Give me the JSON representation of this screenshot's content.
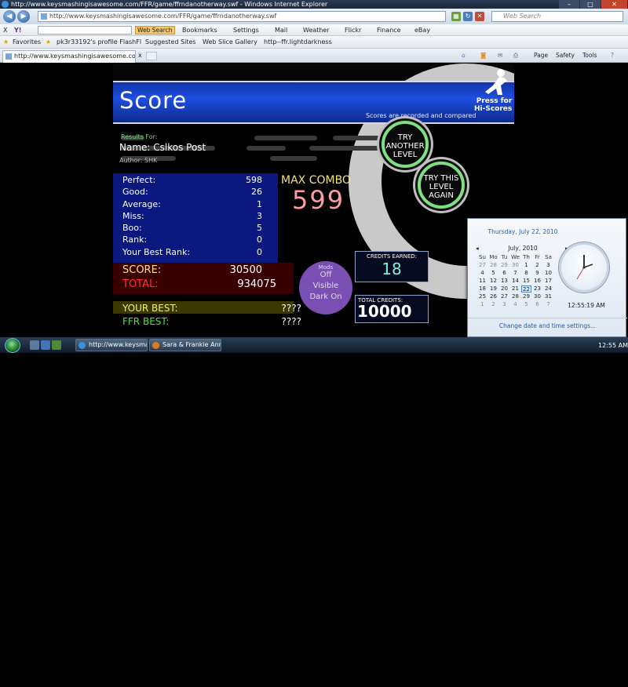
{
  "window": {
    "title": "http://www.keysmashingisawesome.com/FFR/game/ffrndanotherway.swf - Windows Internet Explorer",
    "minimize": "–",
    "maximize": "□",
    "close": "✕"
  },
  "address_bar": {
    "url": "http://www.keysmashingisawesome.com/FFR/game/ffrndanotherway.swf",
    "search_placeholder": "Web Search"
  },
  "yahoo_toolbar": {
    "close": "X",
    "logo": "Y!",
    "web_search": "Web Search",
    "items": [
      "Bookmarks",
      "Settings",
      "Mail",
      "Weather",
      "Flickr",
      "Finance",
      "eBay"
    ]
  },
  "favorites_bar": {
    "favorites": "Favorites",
    "items": [
      "pk3r33192's profile FlashFl...",
      "Suggested Sites",
      "Web Slice Gallery",
      "http--ffr.lightdarkness"
    ]
  },
  "tab": {
    "label": "http://www.keysmashingisawesome.com/FFR/g...",
    "close": "x"
  },
  "command_bar": {
    "items": [
      "Page",
      "Safety",
      "Tools"
    ],
    "help": "?"
  },
  "game": {
    "title": "Score",
    "press_for": "Press for",
    "hi_scores": "Hi-Scores",
    "recorded": "Scores are recorded and compared",
    "results_for": "Results For:",
    "name": "Name: Cslkos Post",
    "author": "Author: SHK",
    "try_another": "TRY ANOTHER LEVEL",
    "try_again": "TRY THIS LEVEL AGAIN",
    "stats": [
      {
        "label": "Perfect:",
        "value": "598"
      },
      {
        "label": "Good:",
        "value": "26"
      },
      {
        "label": "Average:",
        "value": "1"
      },
      {
        "label": "Miss:",
        "value": "3"
      },
      {
        "label": "Boo:",
        "value": "5"
      },
      {
        "label": "Rank:",
        "value": "0"
      },
      {
        "label": "Your Best Rank:",
        "value": "0"
      }
    ],
    "max_combo_label": "MAX COMBO",
    "max_combo": "599",
    "score_label": "SCORE:",
    "score": "30500",
    "total_label": "TOTAL:",
    "total": "934075",
    "your_best_label": "YOUR BEST:",
    "your_best": "????",
    "ffr_best_label": "FFR BEST:",
    "ffr_best": "????",
    "mods_label": "Mods",
    "mods_off": "Off",
    "visible": "Visible",
    "dark_on": "Dark On",
    "credits_earned_label": "CREDITS EARNED:",
    "credits_earned": "18",
    "total_credits_label": "TOTAL CREDITS:",
    "total_credits": "10000"
  },
  "taskbar": {
    "buttons": [
      "http://www.keysma...",
      "Sara & Frankie Anni..."
    ],
    "time": "12:55 AM"
  },
  "clock_panel": {
    "date": "Thursday, July 22, 2010",
    "month": "July, 2010",
    "prev": "◂",
    "next": "▸",
    "weekdays": [
      "Su",
      "Mo",
      "Tu",
      "We",
      "Th",
      "Fr",
      "Sa"
    ],
    "weeks": [
      [
        "27",
        "28",
        "29",
        "30",
        "1",
        "2",
        "3"
      ],
      [
        "4",
        "5",
        "6",
        "7",
        "8",
        "9",
        "10"
      ],
      [
        "11",
        "12",
        "13",
        "14",
        "15",
        "16",
        "17"
      ],
      [
        "18",
        "19",
        "20",
        "21",
        "22",
        "23",
        "24"
      ],
      [
        "25",
        "26",
        "27",
        "28",
        "29",
        "30",
        "31"
      ],
      [
        "1",
        "2",
        "3",
        "4",
        "5",
        "6",
        "7"
      ]
    ],
    "today": "22",
    "time": "12:55:19 AM",
    "link": "Change date and time settings..."
  }
}
